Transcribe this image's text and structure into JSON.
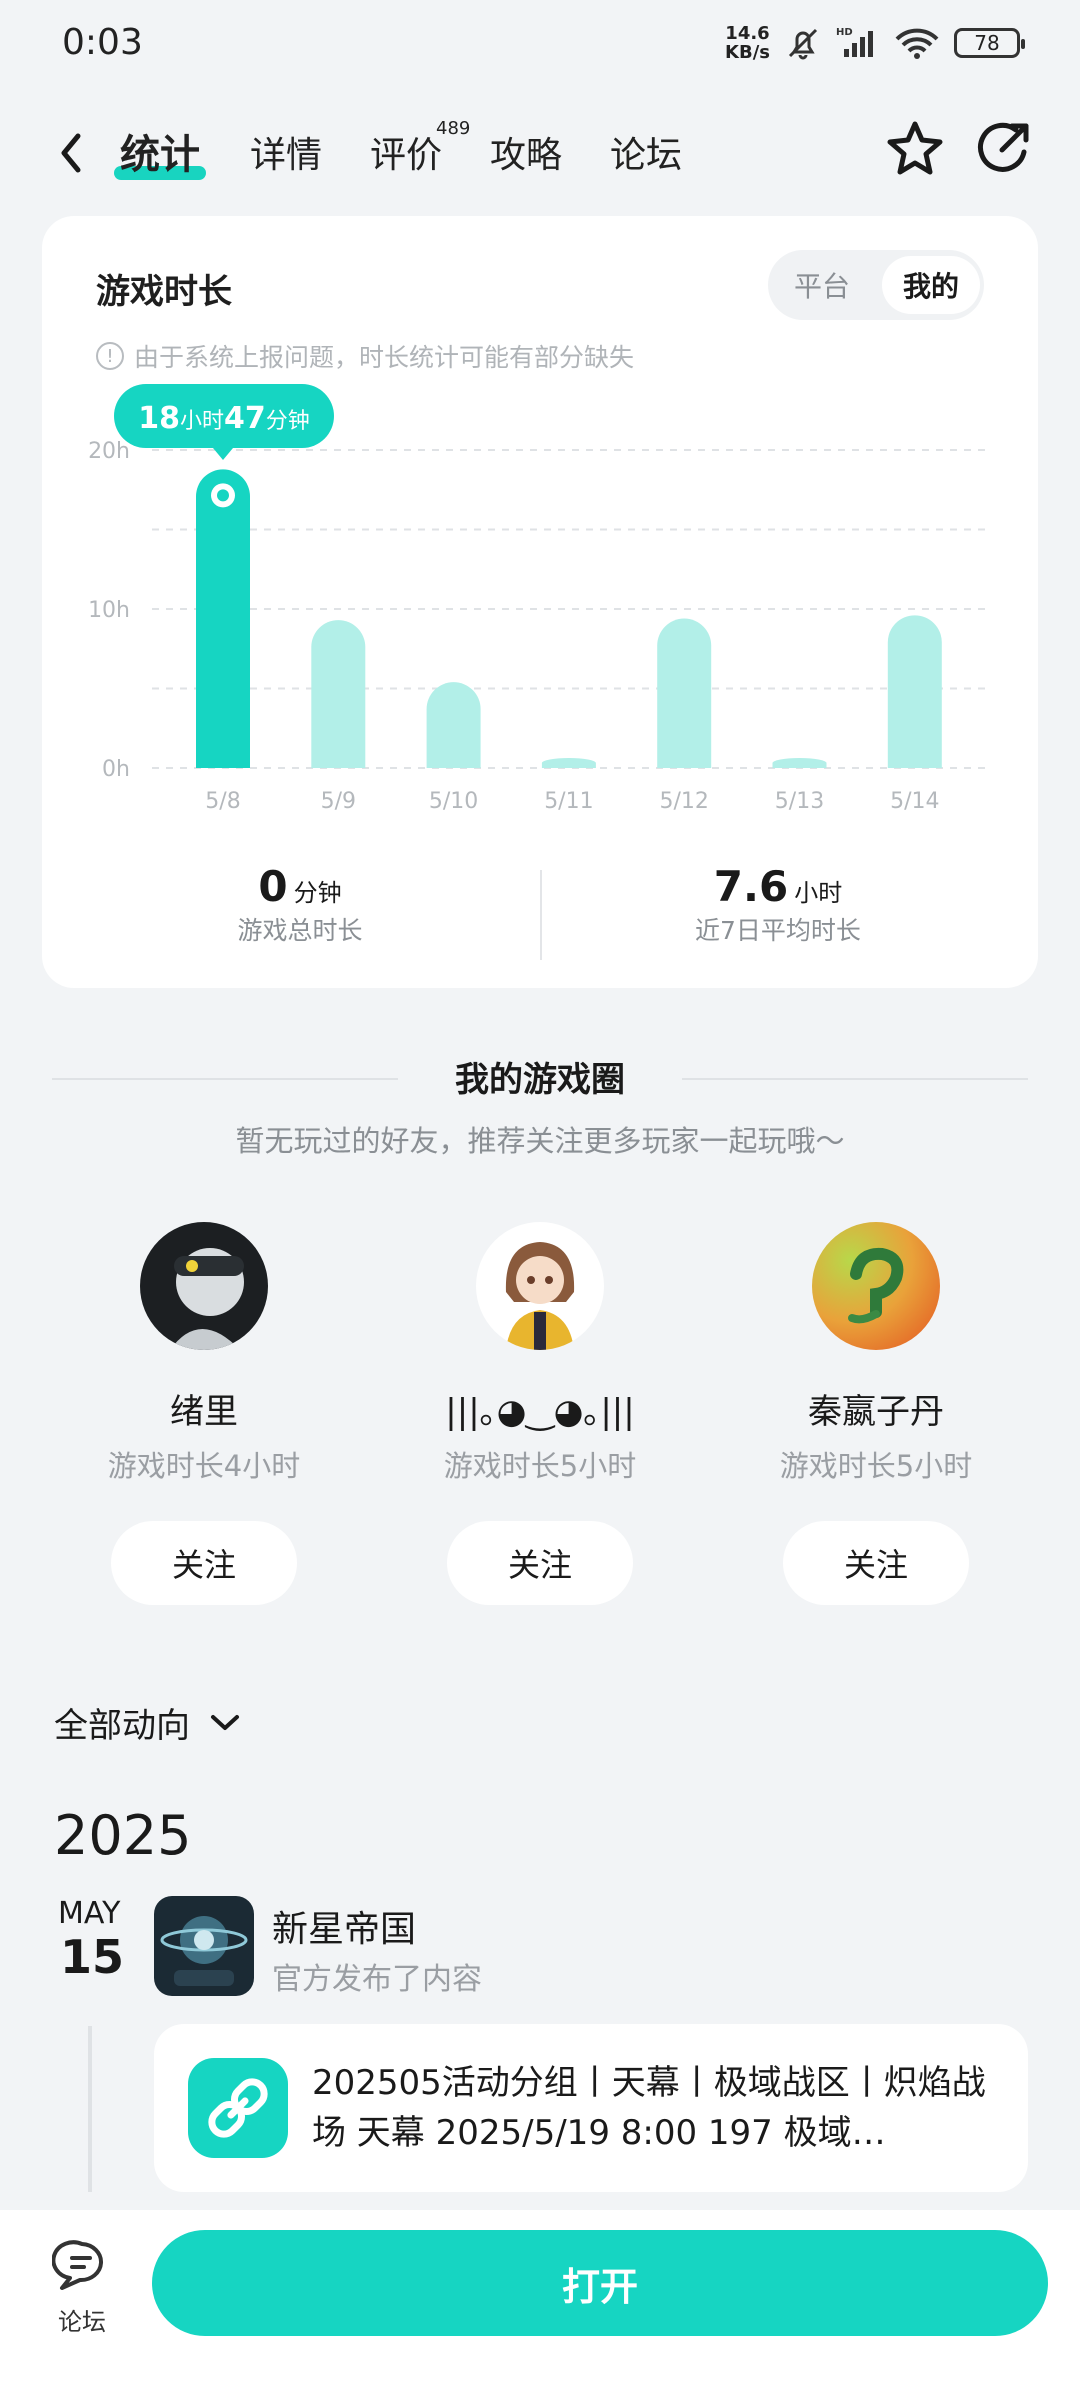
{
  "status_bar": {
    "time": "0:03",
    "net_speed_value": "14.6",
    "net_speed_unit": "KB/s",
    "battery": "78"
  },
  "nav": {
    "tabs": [
      {
        "label": "统计",
        "active": true
      },
      {
        "label": "详情"
      },
      {
        "label": "评价",
        "badge": "489"
      },
      {
        "label": "攻略"
      },
      {
        "label": "论坛"
      }
    ]
  },
  "playtime": {
    "title": "游戏时长",
    "toggle": {
      "platform": "平台",
      "mine": "我的",
      "selected": "我的"
    },
    "notice": "由于系统上报问题，时长统计可能有部分缺失",
    "tooltip": {
      "hours": "18",
      "hours_unit": "小时",
      "minutes": "47",
      "minutes_unit": "分钟"
    },
    "total": {
      "value": "0",
      "unit": "分钟",
      "label": "游戏总时长"
    },
    "average": {
      "value": "7.6",
      "unit": "小时",
      "label": "近7日平均时长"
    }
  },
  "chart_data": {
    "type": "bar",
    "categories": [
      "5/8",
      "5/9",
      "5/10",
      "5/11",
      "5/12",
      "5/13",
      "5/14"
    ],
    "values": [
      18.78,
      9.3,
      5.4,
      0.6,
      9.4,
      0.6,
      9.6
    ],
    "ylim": [
      0,
      20
    ],
    "yticks": [
      "0h",
      "10h",
      "20h"
    ],
    "highlight_index": 0,
    "grid": true,
    "colors": {
      "highlight": "#16d5c2",
      "normal": "#b2efe8",
      "grid": "#dfe2e5"
    }
  },
  "game_circle": {
    "title": "我的游戏圈",
    "subtitle": "暂无玩过的好友，推荐关注更多玩家一起玩哦～",
    "friends": [
      {
        "name": "绪里",
        "playtime": "游戏时长4小时",
        "follow": "关注"
      },
      {
        "name": "|||｡◕‿◕｡|||",
        "playtime": "游戏时长5小时",
        "follow": "关注"
      },
      {
        "name": "秦嬴子丹",
        "playtime": "游戏时长5小时",
        "follow": "关注"
      }
    ]
  },
  "feed": {
    "filter": "全部动向",
    "year": "2025",
    "month": "MAY",
    "day": "15",
    "game_name": "新星帝国",
    "game_action": "官方发布了内容",
    "post_text": "202505活动分组丨天幕丨极域战区丨炽焰战场 天幕 2025/5/19 8:00 197 极域…"
  },
  "bottom": {
    "forum_label": "论坛",
    "open_button": "打开"
  }
}
